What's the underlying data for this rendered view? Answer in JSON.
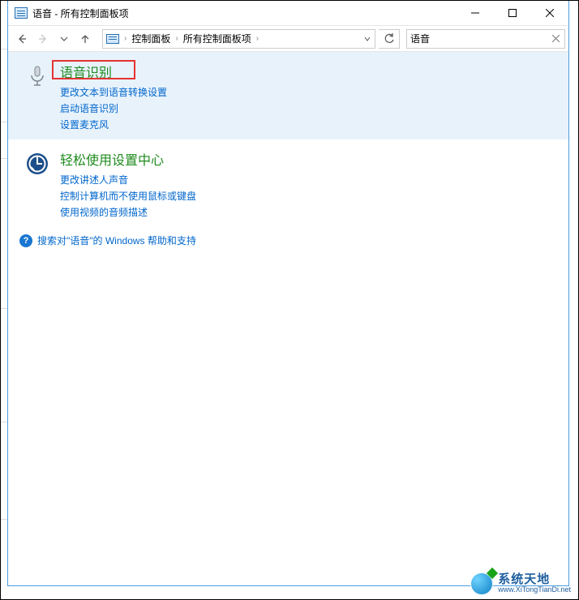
{
  "window": {
    "title": "语音 - 所有控制面板项"
  },
  "breadcrumbs": {
    "items": [
      "控制面板",
      "所有控制面板项"
    ]
  },
  "search": {
    "value": "语音"
  },
  "results": [
    {
      "title": "语音识别",
      "links": [
        "更改文本到语音转换设置",
        "启动语音识别",
        "设置麦克风"
      ]
    },
    {
      "title": "轻松使用设置中心",
      "links": [
        "更改讲述人声音",
        "控制计算机而不使用鼠标或键盘",
        "使用视频的音频描述"
      ]
    }
  ],
  "help": {
    "text": "搜索对\"语音\"的 Windows 帮助和支持"
  },
  "watermark": {
    "line1": "系统天地",
    "line2": "www.XiTongTianDi.net"
  }
}
